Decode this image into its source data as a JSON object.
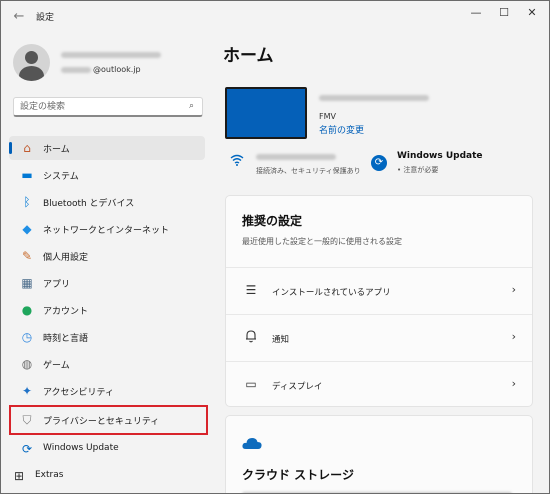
{
  "window": {
    "title": "設定",
    "back": "←",
    "minimize": "—",
    "maximize": "☐",
    "close": "✕"
  },
  "account": {
    "email_suffix": "@outlook.jp"
  },
  "search": {
    "placeholder": "設定の検索",
    "icon": "⌕"
  },
  "sidebar": {
    "items": [
      {
        "label": "ホーム",
        "icon": "⌂",
        "color": "#c15a2e",
        "selected": true
      },
      {
        "label": "システム",
        "icon": "▬",
        "color": "#0078d4"
      },
      {
        "label": "Bluetooth とデバイス",
        "icon": "ᛒ",
        "color": "#0078d4"
      },
      {
        "label": "ネットワークとインターネット",
        "icon": "◆",
        "color": "#1f8fe5"
      },
      {
        "label": "個人用設定",
        "icon": "✎",
        "color": "#c86b2c"
      },
      {
        "label": "アプリ",
        "icon": "▦",
        "color": "#4a6b8a"
      },
      {
        "label": "アカウント",
        "icon": "●",
        "color": "#1fa65c"
      },
      {
        "label": "時刻と言語",
        "icon": "◷",
        "color": "#2e86de"
      },
      {
        "label": "ゲーム",
        "icon": "◍",
        "color": "#6d6d6d"
      },
      {
        "label": "アクセシビリティ",
        "icon": "✦",
        "color": "#1f72c7"
      },
      {
        "label": "プライバシーとセキュリティ",
        "icon": "⛉",
        "color": "#7a7a7a"
      },
      {
        "label": "Windows Update",
        "icon": "⟳",
        "color": "#0067c0"
      },
      {
        "label": "Extras",
        "icon": "⊞",
        "color": "#333333"
      }
    ]
  },
  "main": {
    "title": "ホーム",
    "device": {
      "model": "FMV",
      "rename_link": "名前の変更"
    },
    "network": {
      "status": "接続済み、セキュリティ保護あり"
    },
    "windows_update": {
      "title": "Windows Update",
      "status": "• 注意が必要"
    },
    "recommended": {
      "title": "推奨の設定",
      "subtitle": "最近使用した設定と一般的に使用される設定",
      "rows": [
        {
          "label": "インストールされているアプリ",
          "icon": "☰"
        },
        {
          "label": "通知",
          "icon": "🔔"
        },
        {
          "label": "ディスプレイ",
          "icon": "▭"
        }
      ],
      "chevron": "›"
    },
    "cloud": {
      "title": "クラウド ストレージ"
    }
  },
  "colors": {
    "accent": "#005fb8",
    "highlight": "#d8232a",
    "device": "#0560b8"
  }
}
